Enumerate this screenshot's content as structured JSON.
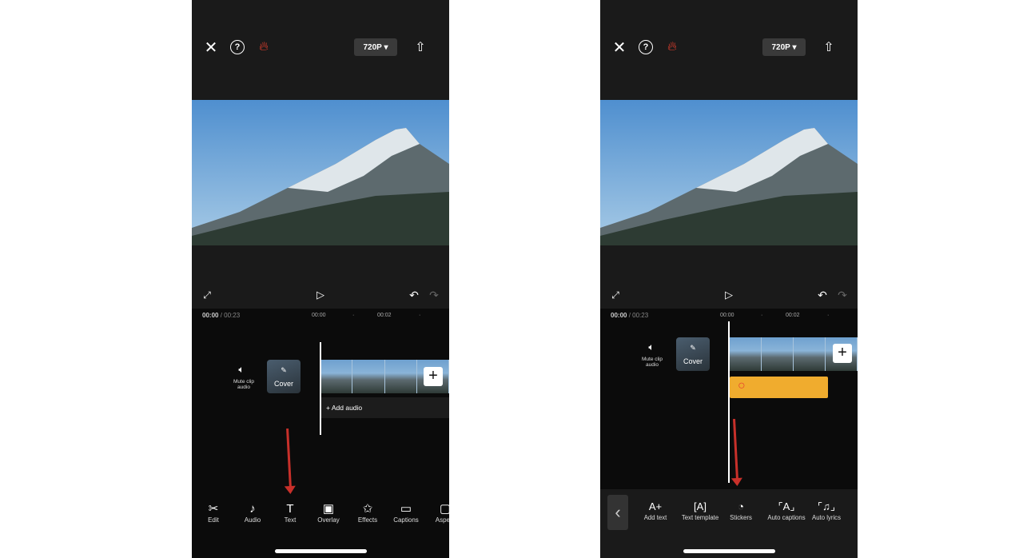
{
  "colors": {
    "accent_flame": "#e8402f",
    "sticker_track": "#f0ac2e",
    "annotation_arrow": "#c8302a"
  },
  "icons": {
    "close": "close-icon",
    "help": "help-icon",
    "flame": "flame-icon",
    "export": "upload-icon",
    "fullscreen": "fullscreen-icon",
    "play": "play-icon",
    "undo": "undo-icon",
    "redo": "redo-icon"
  },
  "left": {
    "resolution": "720P ▾",
    "time_current": "00:00",
    "time_total": "/ 00:23",
    "ruler": [
      "00:00",
      "·",
      "00:02",
      "·"
    ],
    "mute_label": "Mute clip audio",
    "cover_label": "Cover",
    "add_audio": "+ Add audio",
    "toolbar": [
      {
        "label": "Edit",
        "icon": "scissors-icon",
        "g": "✂"
      },
      {
        "label": "Audio",
        "icon": "music-note-icon",
        "g": "♪"
      },
      {
        "label": "Text",
        "icon": "text-icon",
        "g": "T"
      },
      {
        "label": "Overlay",
        "icon": "overlay-icon",
        "g": "▣"
      },
      {
        "label": "Effects",
        "icon": "effects-icon",
        "g": "✩"
      },
      {
        "label": "Captions",
        "icon": "captions-icon",
        "g": "▭"
      },
      {
        "label": "Aspect",
        "icon": "aspect-icon",
        "g": "▢"
      }
    ]
  },
  "right": {
    "resolution": "720P ▾",
    "time_current": "00:00",
    "time_total": "/ 00:23",
    "ruler": [
      "00:00",
      "·",
      "00:02",
      "·"
    ],
    "mute_label": "Mute clip audio",
    "cover_label": "Cover",
    "back": "‹",
    "toolbar": [
      {
        "label": "Add text",
        "icon": "add-text-icon",
        "g": "A+"
      },
      {
        "label": "Text template",
        "icon": "text-template-icon",
        "g": "[A]"
      },
      {
        "label": "Stickers",
        "icon": "stickers-icon",
        "g": "◔"
      },
      {
        "label": "Auto captions",
        "icon": "auto-captions-icon",
        "g": "⌜A⌟"
      },
      {
        "label": "Auto lyrics",
        "icon": "auto-lyrics-icon",
        "g": "⌜♫⌟"
      }
    ]
  }
}
